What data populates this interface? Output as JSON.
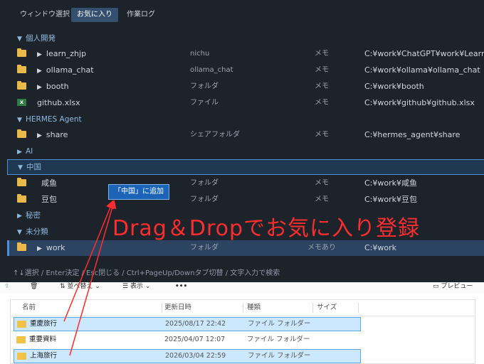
{
  "tabs": [
    "ウィンドウ選択",
    "お気に入り",
    "作業ログ"
  ],
  "groups": {
    "personal": "個人開発",
    "hermes": "HERMES Agent",
    "ai": "AI",
    "china": "中国",
    "secret": "秘密",
    "uncat": "未分類"
  },
  "items": [
    {
      "name": "learn_zhjp",
      "desc": "nichu",
      "memo": "メモ",
      "path": "C:¥work¥ChatGPT¥work¥LearnC"
    },
    {
      "name": "ollama_chat",
      "desc": "ollama_chat",
      "memo": "メモ",
      "path": "C:¥work¥ollama¥ollama_chat"
    },
    {
      "name": "booth",
      "desc": "フォルダ",
      "memo": "メモ",
      "path": "C:¥work¥booth"
    },
    {
      "name": "github.xlsx",
      "desc": "ファイル",
      "memo": "メモ",
      "path": "C:¥work¥github¥github.xlsx"
    },
    {
      "name": "share",
      "desc": "シェアフォルダ",
      "memo": "メモ",
      "path": "C:¥hermes_agent¥share"
    },
    {
      "name": "咸鱼",
      "desc": "フォルダ",
      "memo": "メモ",
      "path": "C:¥work¥咸鱼"
    },
    {
      "name": "豆包",
      "desc": "フォルダ",
      "memo": "メモ",
      "path": "C:¥work¥豆包"
    },
    {
      "name": "work",
      "desc": "フォルダ",
      "memo": "メモあり",
      "path": "C:¥work"
    }
  ],
  "tooltip": "「中国」に追加",
  "status_text": "↑↓選択 / Enter決定 / Esc閉じる / Ctrl+PageUp/Downタブ切替 / 文字入力で検索",
  "annotation": "Drag＆Dropでお気に入り登録",
  "annotation_color": "#ff2d2d",
  "toolbar": {
    "sort": "並べ替え",
    "view": "表示",
    "more": "•••",
    "preview": "プレビュー"
  },
  "columns": {
    "name": "名前",
    "date": "更新日時",
    "type": "種類",
    "size": "サイズ"
  },
  "files": [
    {
      "name": "重慶旅行",
      "date": "2025/08/17 22:42",
      "type": "ファイル フォルダー"
    },
    {
      "name": "重要資料",
      "date": "2025/04/07 12:07",
      "type": "ファイル フォルダー"
    },
    {
      "name": "上海旅行",
      "date": "2026/03/04 22:59",
      "type": "ファイル フォルダー"
    }
  ]
}
